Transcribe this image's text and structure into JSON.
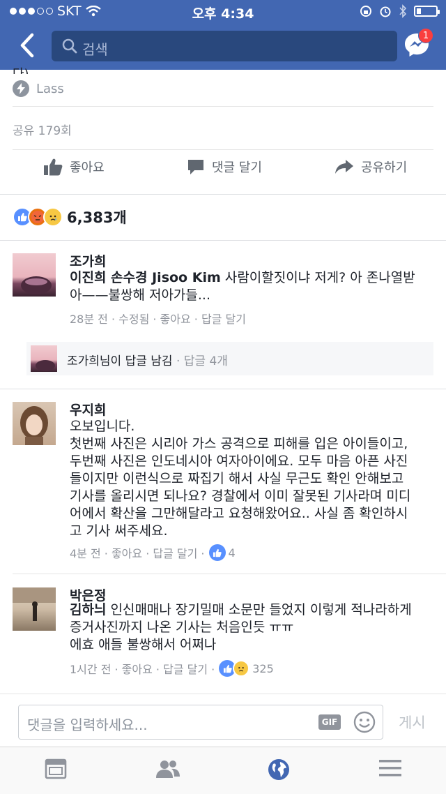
{
  "status_bar": {
    "carrier": "SKT",
    "time": "오후 4:34"
  },
  "header": {
    "search_placeholder": "검색",
    "messenger_badge": "1"
  },
  "post": {
    "cut_text": "다)",
    "source": "Lass",
    "shares": "공유 179회",
    "actions": {
      "like": "좋아요",
      "comment": "댓글 달기",
      "share": "공유하기"
    },
    "reaction_count": "6,383개"
  },
  "comments": [
    {
      "name": "조가희",
      "tags": "이진희 손수경 Jisoo Kim",
      "text_line1": " 사람이할짓이냐 저게? 아 존나열받",
      "text_line2": "아——불쌍해 저아가들...",
      "meta": "28분 전 · 수정됨 · 좋아요 · 답글 달기",
      "reply_author": "조가희",
      "reply_text": "님이 답글 남김",
      "reply_count": " · 답글 4개"
    },
    {
      "name": "우지희",
      "lines": [
        "오보입니다.",
        "첫번째 사진은 시리아 가스 공격으로 피해를 입은 아이들이고,",
        "두번째 사진은 인도네시아 여자아이에요.  모두 마음 아픈 사진",
        "들이지만 이런식으로 짜집기 해서 사실 무근도 확인 안해보고",
        "기사를 올리시면 되나요? 경찰에서 이미 잘못된 기사라며 미디",
        "어에서 확산을 그만해달라고 요청해왔어요.. 사실 좀 확인하시",
        "고 기사 써주세요."
      ],
      "meta": "4분 전 · 좋아요 · 답글 달기 ·",
      "reactions": "4"
    },
    {
      "name": "박은정",
      "tag": "김하늬",
      "line1": " 인신매매나 장기밀매 소문만 들었지 이렇게 적나라하게",
      "line2": "증거사진까지 나온 기사는 처음인듯 ㅠㅠ",
      "line3": "에효 애들 불쌍해서 어쩌나",
      "meta": "1시간 전 · 좋아요 · 답글 달기 ·",
      "reactions": "325"
    }
  ],
  "composer": {
    "placeholder": "댓글을 입력하세요...",
    "gif": "GIF",
    "post_label": "게시"
  },
  "colors": {
    "brand": "#4267b2",
    "search_bg": "#29487d",
    "like_blue": "#5890ff",
    "meta_gray": "#90949c"
  }
}
